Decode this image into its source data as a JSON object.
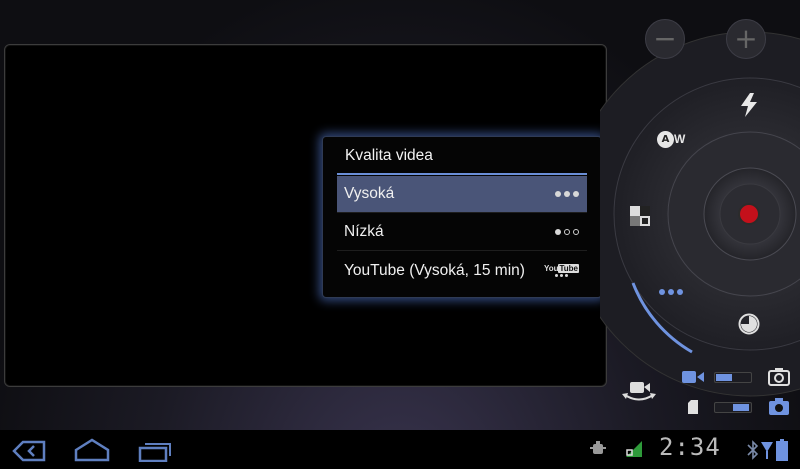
{
  "quality_menu": {
    "title": "Kvalita videa",
    "options": [
      {
        "label": "Vysoká",
        "selected": true
      },
      {
        "label": "Nízká",
        "selected": false
      },
      {
        "label": "YouTube (Vysoká, 15 min)",
        "selected": false
      }
    ]
  },
  "controls": {
    "zoom_out": "−",
    "zoom_in": "+",
    "white_balance": {
      "a": "A",
      "w": "W"
    }
  },
  "youtube_badge": {
    "text": "You",
    "text2": "Tube"
  },
  "status_bar": {
    "clock": "2:34"
  },
  "colors": {
    "accent": "#6f93e0",
    "record": "#c4101b",
    "selected_row": "#4a5578"
  },
  "icons": [
    "back-icon",
    "home-icon",
    "recent-apps-icon",
    "usb-debug-icon",
    "wifi-icon",
    "bluetooth-icon",
    "battery-icon",
    "flash-icon",
    "white-balance-icon",
    "color-effect-icon",
    "video-quality-icon",
    "time-lapse-icon",
    "video-mode-icon",
    "camera-mode-icon",
    "camera-switch-icon"
  ]
}
